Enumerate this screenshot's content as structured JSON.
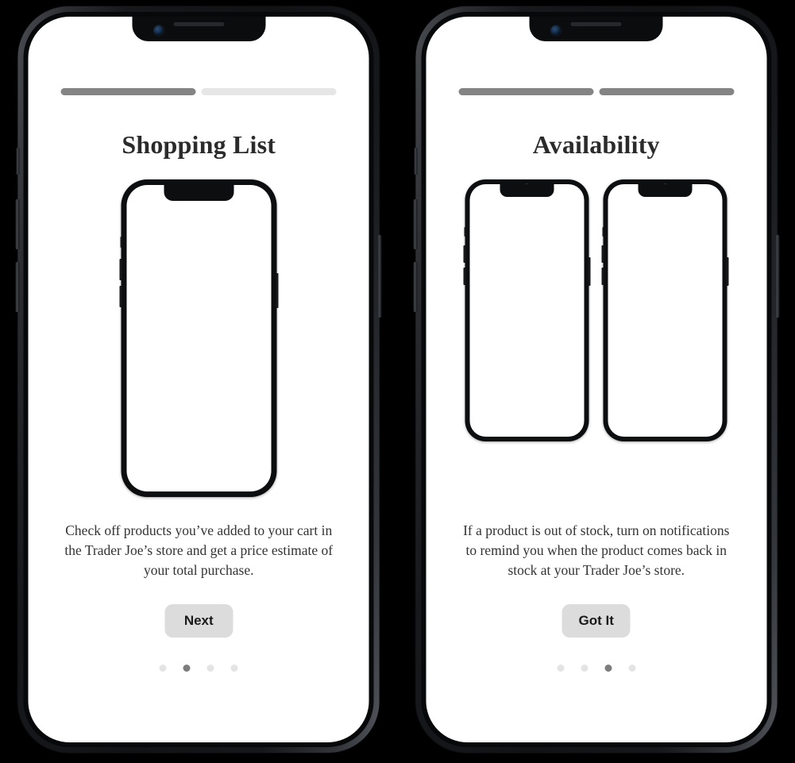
{
  "screens": [
    {
      "id": "shopping-list",
      "title": "Shopping List",
      "progress": {
        "segments": 2,
        "filled": 1
      },
      "mock_count": 1,
      "body": "Check off products you’ve added to your cart in the Trader Joe’s store and get a price estimate of your total purchase.",
      "cta_label": "Next",
      "dots": {
        "count": 4,
        "active_index": 1
      }
    },
    {
      "id": "availability",
      "title": "Availability",
      "progress": {
        "segments": 2,
        "filled": 2
      },
      "mock_count": 2,
      "body": "If a product is out of stock,  turn on notifications  to remind you when the product comes back in stock at your Trader Joe’s store.",
      "cta_label": "Got It",
      "dots": {
        "count": 4,
        "active_index": 2
      }
    }
  ],
  "colors": {
    "progress_filled": "#848484",
    "progress_empty": "#e6e6e6",
    "dot_active": "#7d7d7d",
    "dot_inactive": "#e4e4e4",
    "cta_background": "#dcdcdc",
    "cta_text": "#1a1a1a",
    "title_text": "#2b2b2b",
    "body_text": "#333333",
    "device_body": "#101214",
    "screen_background": "#ffffff",
    "page_background": "#000000"
  },
  "icons": {
    "front_camera": "camera-icon",
    "earpiece_speaker": "speaker-icon",
    "mute_switch": "mute-switch-icon",
    "volume_up": "volume-up-button-icon",
    "volume_down": "volume-down-button-icon",
    "power": "power-button-icon"
  }
}
